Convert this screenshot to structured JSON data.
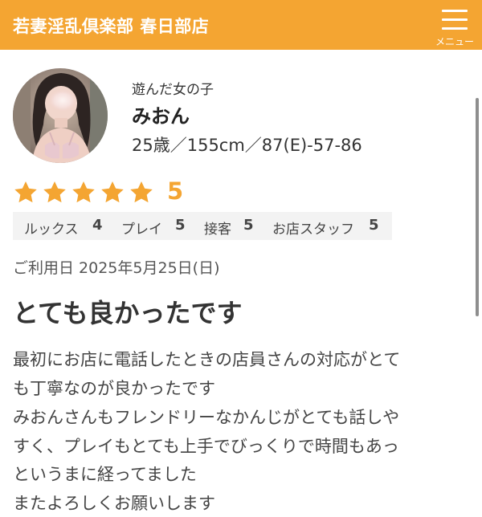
{
  "header": {
    "title": "若妻淫乱倶楽部 春日部店",
    "menu_label": "メニュー",
    "background_color": "#f4a532"
  },
  "girl": {
    "section_label": "遊んだ女の子",
    "name": "みおん",
    "stats": "25歳／155cm／87(E)-57-86"
  },
  "rating": {
    "overall": "5",
    "stars_filled": 5,
    "stars_total": 5,
    "star_color": "#f4a532",
    "categories": [
      {
        "label": "ルックス",
        "value": "4"
      },
      {
        "label": "プレイ",
        "value": "5"
      },
      {
        "label": "接客",
        "value": "5"
      },
      {
        "label": "お店スタッフ",
        "value": "5"
      }
    ]
  },
  "review": {
    "date": "ご利用日 2025年5月25日(日)",
    "title": "とても良かったです",
    "body_lines": [
      "最初にお店に電話したときの店員さんの対応がとて",
      "も丁寧なのが良かったです",
      "みおんさんもフレンドリーなかんじがとても話しや",
      "すく、プレイもとても上手でびっくりで時間もあっ",
      "というまに経ってました",
      "またよろしくお願いします"
    ]
  }
}
